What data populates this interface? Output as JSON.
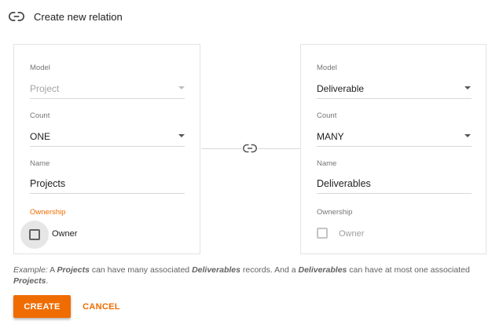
{
  "header": {
    "title": "Create new relation",
    "icon": "link-icon"
  },
  "left_card": {
    "model_label": "Model",
    "model_value": "Project",
    "count_label": "Count",
    "count_value": "ONE",
    "name_label": "Name",
    "name_value": "Projects",
    "ownership_label": "Ownership",
    "owner_label": "Owner",
    "owner_checked": false
  },
  "right_card": {
    "model_label": "Model",
    "model_value": "Deliverable",
    "count_label": "Count",
    "count_value": "MANY",
    "name_label": "Name",
    "name_value": "Deliverables",
    "ownership_label": "Ownership",
    "owner_label": "Owner",
    "owner_checked": false
  },
  "example": {
    "prefix": "Example:",
    "t1": " A ",
    "e1": "Projects",
    "t2": " can have many associated ",
    "e2": "Deliverables",
    "t3": " records. And a ",
    "e3": "Deliverables",
    "t4": " can have at most one associated ",
    "e4": "Projects",
    "t5": "."
  },
  "buttons": {
    "create": "CREATE",
    "cancel": "CANCEL"
  },
  "colors": {
    "accent": "#ef6c00"
  }
}
